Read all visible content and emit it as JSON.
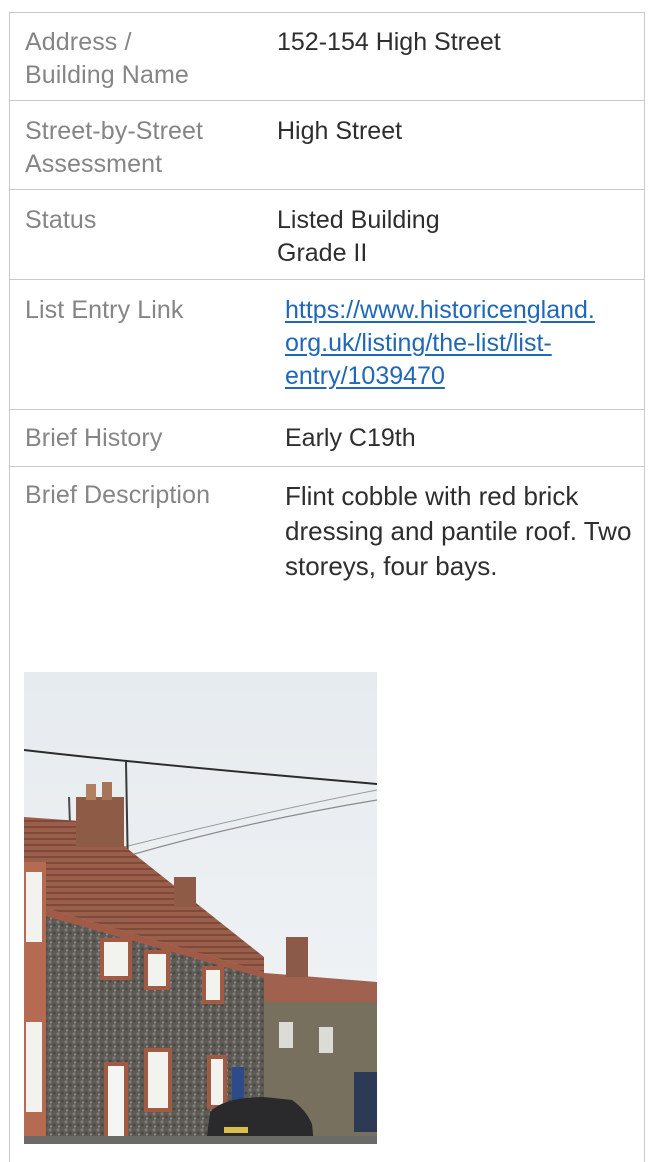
{
  "record": {
    "address": {
      "label_lines": [
        "Address /",
        "Building Name"
      ],
      "value": "152-154 High Street"
    },
    "street": {
      "label_lines": [
        "Street-by-Street",
        "Assessment"
      ],
      "value": "High Street"
    },
    "status": {
      "label": "Status",
      "value_lines": [
        "Listed Building",
        "Grade II"
      ]
    },
    "list_entry": {
      "label": "List Entry Link",
      "link_lines": [
        "https://www.historicengland.",
        "org.uk/listing/the-list/list-",
        "entry/1039470"
      ]
    },
    "history": {
      "label": "Brief History",
      "value": "Early C19th"
    },
    "description": {
      "label": "Brief Description",
      "value_lines": [
        "Flint cobble with red brick",
        "dressing and pantile roof. Two",
        "storeys, four bays."
      ]
    }
  },
  "colors": {
    "label_text": "#858585",
    "value_text": "#2e2e2e",
    "link": "#1f67b7",
    "rule": "#c9c9c9"
  }
}
